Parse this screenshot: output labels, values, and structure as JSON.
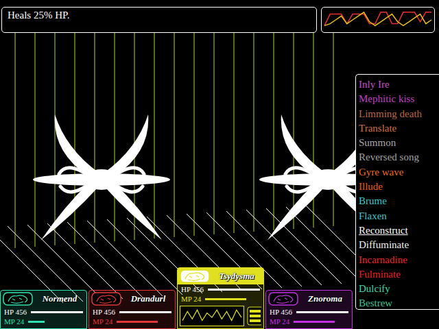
{
  "message": {
    "text": "Heals 25% HP."
  },
  "chart": {
    "series": [
      {
        "color": "#e83030",
        "values": [
          2,
          8,
          8,
          8,
          3,
          8,
          8,
          8,
          3,
          3,
          9,
          9,
          3,
          3,
          9,
          9,
          9,
          4,
          9,
          9
        ]
      },
      {
        "color": "#e8c020",
        "values": [
          2,
          3,
          5,
          7,
          3,
          5,
          7,
          9,
          4,
          2,
          4,
          6,
          8,
          4,
          2,
          4,
          6,
          8,
          3,
          5
        ]
      }
    ]
  },
  "skills": [
    {
      "label": "Inly Ire",
      "color": "#c050c8",
      "selected": false
    },
    {
      "label": "Mephitic kiss",
      "color": "#c040c0",
      "selected": false
    },
    {
      "label": "Limming death",
      "color": "#b86848",
      "selected": false
    },
    {
      "label": "Translate",
      "color": "#d07048",
      "selected": false
    },
    {
      "label": "Summon",
      "color": "#a8a8a8",
      "selected": false
    },
    {
      "label": "Reversed song",
      "color": "#a0a0a0",
      "selected": false
    },
    {
      "label": "Gyre wave",
      "color": "#e86a20",
      "selected": false
    },
    {
      "label": "Illude",
      "color": "#e86010",
      "selected": false
    },
    {
      "label": "Brume",
      "color": "#40c8c8",
      "selected": false
    },
    {
      "label": "Flaxen",
      "color": "#48c0c0",
      "selected": false
    },
    {
      "label": "Reconstruct",
      "color": "#ffffff",
      "selected": true
    },
    {
      "label": "Diffuminate",
      "color": "#f0f0f0",
      "selected": false
    },
    {
      "label": "Incarnadine",
      "color": "#e82828",
      "selected": false
    },
    {
      "label": "Fulminate",
      "color": "#e82020",
      "selected": false
    },
    {
      "label": "Dulcify",
      "color": "#40d8a8",
      "selected": false
    },
    {
      "label": "Bestrew",
      "color": "#40c090",
      "selected": false
    }
  ],
  "party": [
    {
      "name": "Normend",
      "hp": "HP 456",
      "mp": "MP 24",
      "hp_level": 1,
      "mp_level": 0.3,
      "color": "#30e0b0",
      "selected": false,
      "kind": "plain"
    },
    {
      "name": "Drandurl",
      "hp": "HP 456",
      "mp": "MP 24",
      "hp_level": 1,
      "mp_level": 0.75,
      "color": "#e03838",
      "selected": false,
      "kind": "plain"
    },
    {
      "name": "Tsydysma",
      "hp": "HP 456",
      "mp": "MP 24",
      "hp_level": 1,
      "mp_level": 0.75,
      "color": "#e0e020",
      "selected": true,
      "kind": "active",
      "wave": [
        2,
        8,
        3,
        9,
        2,
        7,
        4,
        9,
        3,
        8,
        2,
        9,
        4
      ]
    },
    {
      "name": "Znoroma",
      "hp": "HP 456",
      "mp": "MP 24",
      "hp_level": 1,
      "mp_level": 0.75,
      "color": "#c030e0",
      "selected": false,
      "kind": "plain"
    }
  ]
}
